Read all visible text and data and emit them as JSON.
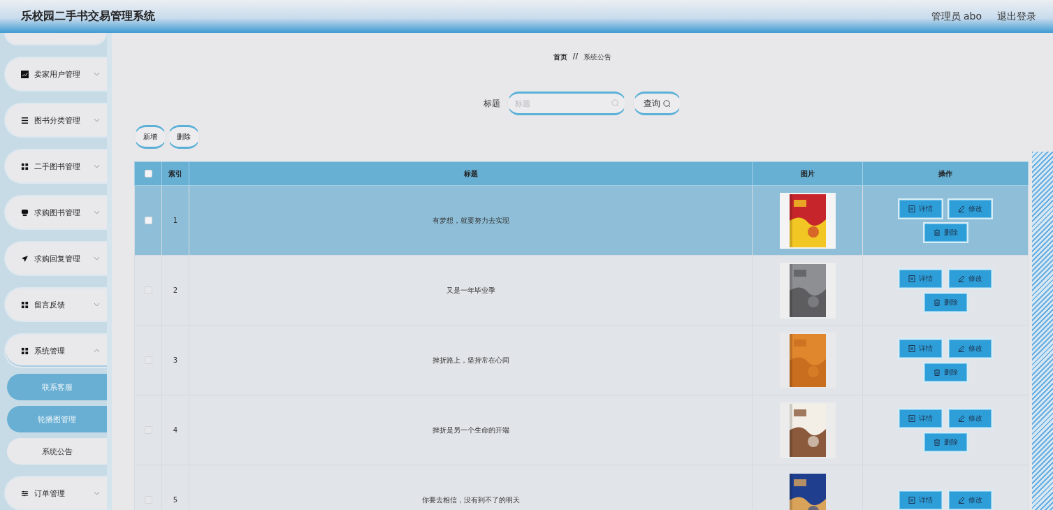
{
  "header": {
    "title": "乐校园二手书交易管理系统",
    "user": "管理员 abo",
    "logout": "退出登录"
  },
  "sidebar": {
    "items": [
      {
        "label": "卖家用户管理",
        "kind": "chart",
        "expanded": false
      },
      {
        "label": "图书分类管理",
        "kind": "list",
        "expanded": false
      },
      {
        "label": "二手图书管理",
        "kind": "grid",
        "expanded": false
      },
      {
        "label": "求购图书管理",
        "kind": "monitor",
        "expanded": false
      },
      {
        "label": "求购回复管理",
        "kind": "send",
        "expanded": false
      },
      {
        "label": "留言反馈",
        "kind": "grid",
        "expanded": false
      },
      {
        "label": "系统管理",
        "kind": "grid",
        "expanded": true,
        "children": [
          {
            "label": "联系客服",
            "selected": false
          },
          {
            "label": "轮播图管理",
            "selected": false
          },
          {
            "label": "系统公告",
            "selected": true
          }
        ]
      },
      {
        "label": "订单管理",
        "kind": "sliders",
        "expanded": false
      }
    ]
  },
  "breadcrumb": {
    "home": "首页",
    "separator": "//",
    "current": "系统公告"
  },
  "search": {
    "label": "标题",
    "placeholder": "标题",
    "button": "查询"
  },
  "toolbar": [
    "新增",
    "删除"
  ],
  "table": {
    "columns": [
      "索引",
      "标题",
      "图片",
      "操作"
    ],
    "header_checked": false,
    "rows": [
      {
        "index": "1",
        "title": "有梦想，就要努力去实现",
        "picture": {
          "kind": "picture"
        },
        "selected": true,
        "checked": false,
        "actions": [
          "详情",
          "修改",
          "删除"
        ]
      },
      {
        "index": "2",
        "title": "又是一年毕业季",
        "picture": {
          "kind": "picture"
        },
        "selected": false,
        "checked": false,
        "actions": [
          "详情",
          "修改",
          "删除"
        ]
      },
      {
        "index": "3",
        "title": "挫折路上，坚持常在心间",
        "picture": {
          "kind": "picture"
        },
        "selected": false,
        "checked": false,
        "actions": [
          "详情",
          "修改",
          "删除"
        ]
      },
      {
        "index": "4",
        "title": "挫折是另一个生命的开端",
        "picture": {
          "kind": "picture"
        },
        "selected": false,
        "checked": false,
        "actions": [
          "详情",
          "修改",
          "删除"
        ]
      },
      {
        "index": "5",
        "title": "你要去相信，没有到不了的明天",
        "picture": {
          "kind": "picture"
        },
        "selected": false,
        "checked": false,
        "actions": [
          "详情",
          "修改"
        ]
      }
    ]
  }
}
